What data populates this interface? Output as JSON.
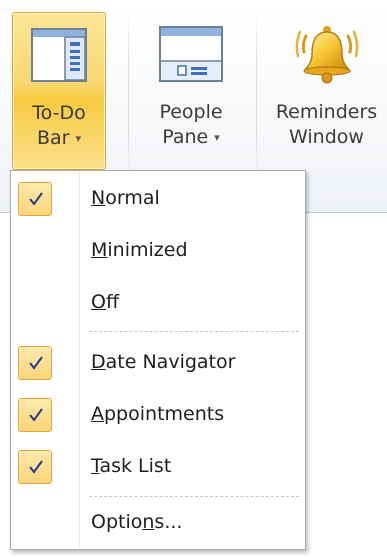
{
  "ribbon": {
    "todo_bar": {
      "line1": "To-Do",
      "line2": "Bar",
      "arrow": "▾"
    },
    "people_pane": {
      "line1": "People",
      "line2": "Pane",
      "arrow": "▾"
    },
    "reminders": {
      "line1": "Reminders",
      "line2": "Window"
    }
  },
  "menu": {
    "items": [
      {
        "pre": "",
        "u": "N",
        "post": "ormal",
        "checked": true
      },
      {
        "pre": "",
        "u": "M",
        "post": "inimized",
        "checked": false
      },
      {
        "pre": "",
        "u": "O",
        "post": "ff",
        "checked": false
      },
      {
        "pre": "",
        "u": "D",
        "post": "ate Navigator",
        "checked": true
      },
      {
        "pre": "",
        "u": "A",
        "post": "ppointments",
        "checked": true
      },
      {
        "pre": "",
        "u": "T",
        "post": "ask List",
        "checked": true
      },
      {
        "pre": "Optio",
        "u": "n",
        "post": "s...",
        "checked": false
      }
    ]
  },
  "colors": {
    "active_button": "#f9d870",
    "check_fill": "#fbd57a",
    "check_border": "#e6a63c",
    "check_mark": "#1f3f86"
  }
}
